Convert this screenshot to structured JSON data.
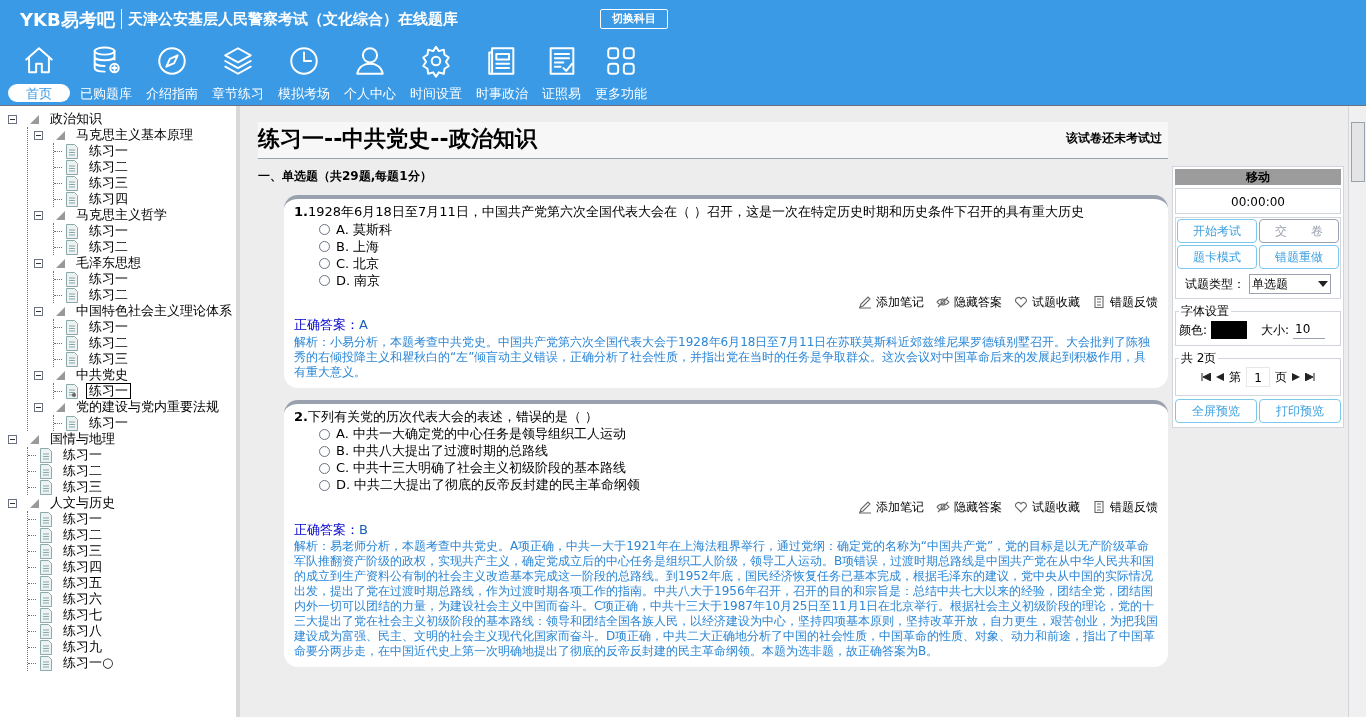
{
  "header": {
    "logo": "YKB易考吧",
    "title": "天津公安基层人民警察考试（文化综合）在线题库",
    "switch_button": "切换科目"
  },
  "nav": [
    {
      "label": "首页",
      "selected": true
    },
    {
      "label": "已购题库",
      "selected": false
    },
    {
      "label": "介绍指南",
      "selected": false
    },
    {
      "label": "章节练习",
      "selected": false
    },
    {
      "label": "模拟考场",
      "selected": false
    },
    {
      "label": "个人中心",
      "selected": false
    },
    {
      "label": "时间设置",
      "selected": false
    },
    {
      "label": "时事政治",
      "selected": false
    },
    {
      "label": "证照易",
      "selected": false
    },
    {
      "label": "更多功能",
      "selected": false
    }
  ],
  "tree": [
    {
      "label": "政治知识",
      "expanded": true,
      "children": [
        {
          "label": "马克思主义基本原理",
          "expanded": true,
          "children": [
            {
              "label": "练习一",
              "selected": false
            },
            {
              "label": "练习二",
              "selected": false
            },
            {
              "label": "练习三",
              "selected": false
            },
            {
              "label": "练习四",
              "selected": false
            }
          ]
        },
        {
          "label": "马克思主义哲学",
          "expanded": true,
          "children": [
            {
              "label": "练习一",
              "selected": false
            },
            {
              "label": "练习二",
              "selected": false
            }
          ]
        },
        {
          "label": "毛泽东思想",
          "expanded": true,
          "children": [
            {
              "label": "练习一",
              "selected": false
            },
            {
              "label": "练习二",
              "selected": false
            }
          ]
        },
        {
          "label": "中国特色社会主义理论体系",
          "expanded": true,
          "children": [
            {
              "label": "练习一",
              "selected": false
            },
            {
              "label": "练习二",
              "selected": false
            },
            {
              "label": "练习三",
              "selected": false
            }
          ]
        },
        {
          "label": "中共党史",
          "expanded": true,
          "children": [
            {
              "label": "练习一",
              "selected": true
            }
          ]
        },
        {
          "label": "党的建设与党内重要法规",
          "expanded": true,
          "children": [
            {
              "label": "练习一",
              "selected": false
            }
          ]
        }
      ]
    },
    {
      "label": "国情与地理",
      "expanded": true,
      "children": [
        {
          "label": "练习一",
          "selected": false
        },
        {
          "label": "练习二",
          "selected": false
        },
        {
          "label": "练习三",
          "selected": false
        }
      ]
    },
    {
      "label": "人文与历史",
      "expanded": true,
      "children": [
        {
          "label": "练习一",
          "selected": false
        },
        {
          "label": "练习二",
          "selected": false
        },
        {
          "label": "练习三",
          "selected": false
        },
        {
          "label": "练习四",
          "selected": false
        },
        {
          "label": "练习五",
          "selected": false
        },
        {
          "label": "练习六",
          "selected": false
        },
        {
          "label": "练习七",
          "selected": false
        },
        {
          "label": "练习八",
          "selected": false
        },
        {
          "label": "练习九",
          "selected": false
        },
        {
          "label": "练习一○",
          "selected": false
        }
      ]
    }
  ],
  "paper": {
    "title": "练习一--中共党史--政治知识",
    "status": "该试卷还未考试过",
    "section": "一、单选题（共29题,每题1分）",
    "questions": [
      {
        "number": "1.",
        "text": "1928年6月18日至7月11日，中国共产党第六次全国代表大会在（ ）召开，这是一次在特定历史时期和历史条件下召开的具有重大历史",
        "options": [
          {
            "letter": "A.",
            "text": "莫斯科",
            "selected": false
          },
          {
            "letter": "B.",
            "text": "上海",
            "selected": false
          },
          {
            "letter": "C.",
            "text": "北京",
            "selected": false
          },
          {
            "letter": "D.",
            "text": "南京",
            "selected": false
          }
        ],
        "tools": [
          "添加笔记",
          "隐藏答案",
          "试题收藏",
          "错题反馈"
        ],
        "answer_label": "正确答案：",
        "answer": "A",
        "analysis": "解析：小易分析，本题考查中共党史。中国共产党第六次全国代表大会于1928年6月18日至7月11日在苏联莫斯科近郊兹维尼果罗德镇别墅召开。大会批判了陈独秀的右倾投降主义和瞿秋白的“左”倾盲动主义错误，正确分析了社会性质，并指出党在当时的任务是争取群众。这次会议对中国革命后来的发展起到积极作用，具有重大意义。"
      },
      {
        "number": "2.",
        "text": "下列有关党的历次代表大会的表述，错误的是（ ）",
        "options": [
          {
            "letter": "A.",
            "text": "中共一大确定党的中心任务是领导组织工人运动",
            "selected": false
          },
          {
            "letter": "B.",
            "text": "中共八大提出了过渡时期的总路线",
            "selected": false
          },
          {
            "letter": "C.",
            "text": "中共十三大明确了社会主义初级阶段的基本路线",
            "selected": false
          },
          {
            "letter": "D.",
            "text": "中共二大提出了彻底的反帝反封建的民主革命纲领",
            "selected": false
          }
        ],
        "tools": [
          "添加笔记",
          "隐藏答案",
          "试题收藏",
          "错题反馈"
        ],
        "answer_label": "正确答案：",
        "answer": "B",
        "analysis": "解析：易老师分析，本题考查中共党史。A项正确，中共一大于1921年在上海法租界举行，通过党纲：确定党的名称为“中国共产党”，党的目标是以无产阶级革命军队推翻资产阶级的政权，实现共产主义，确定党成立后的中心任务是组织工人阶级，领导工人运动。B项错误，过渡时期总路线是中国共产党在从中华人民共和国的成立到生产资料公有制的社会主义改造基本完成这一阶段的总路线。到1952年底，国民经济恢复任务已基本完成，根据毛泽东的建议，党中央从中国的实际情况出发，提出了党在过渡时期总路线，作为过渡时期各项工作的指南。中共八大于1956年召开，召开的目的和宗旨是：总结中共七大以来的经验，团结全党，团结国内外一切可以团结的力量，为建设社会主义中国而奋斗。C项正确，中共十三大于1987年10月25日至11月1日在北京举行。根据社会主义初级阶段的理论，党的十三大提出了党在社会主义初级阶段的基本路线：领导和团结全国各族人民，以经济建设为中心，坚持四项基本原则，坚持改革开放，自力更生，艰苦创业，为把我国建设成为富强、民主、文明的社会主义现代化国家而奋斗。D项正确，中共二大正确地分析了中国的社会性质，中国革命的性质、对象、动力和前途，指出了中国革命要分两步走，在中国近代史上第一次明确地提出了彻底的反帝反封建的民主革命纲领。本题为选非题，故正确答案为B。"
      }
    ]
  },
  "panel": {
    "move": "移动",
    "timer": "00:00:00",
    "buttons": [
      {
        "label": "开始考试",
        "disabled": false
      },
      {
        "label": "交　　卷",
        "disabled": true
      },
      {
        "label": "题卡模式",
        "disabled": false
      },
      {
        "label": "错题重做",
        "disabled": false
      }
    ],
    "type_label": "试题类型：",
    "type_value": "单选题",
    "font_legend": "字体设置",
    "color_label": "颜色:",
    "color": "#000000",
    "size_label": "大小:",
    "size_value": "10",
    "page_legend": "共 2页",
    "page_prefix": "第",
    "page_value": "1",
    "page_suffix": "页",
    "preview_buttons": [
      "全屏预览",
      "打印预览"
    ]
  }
}
